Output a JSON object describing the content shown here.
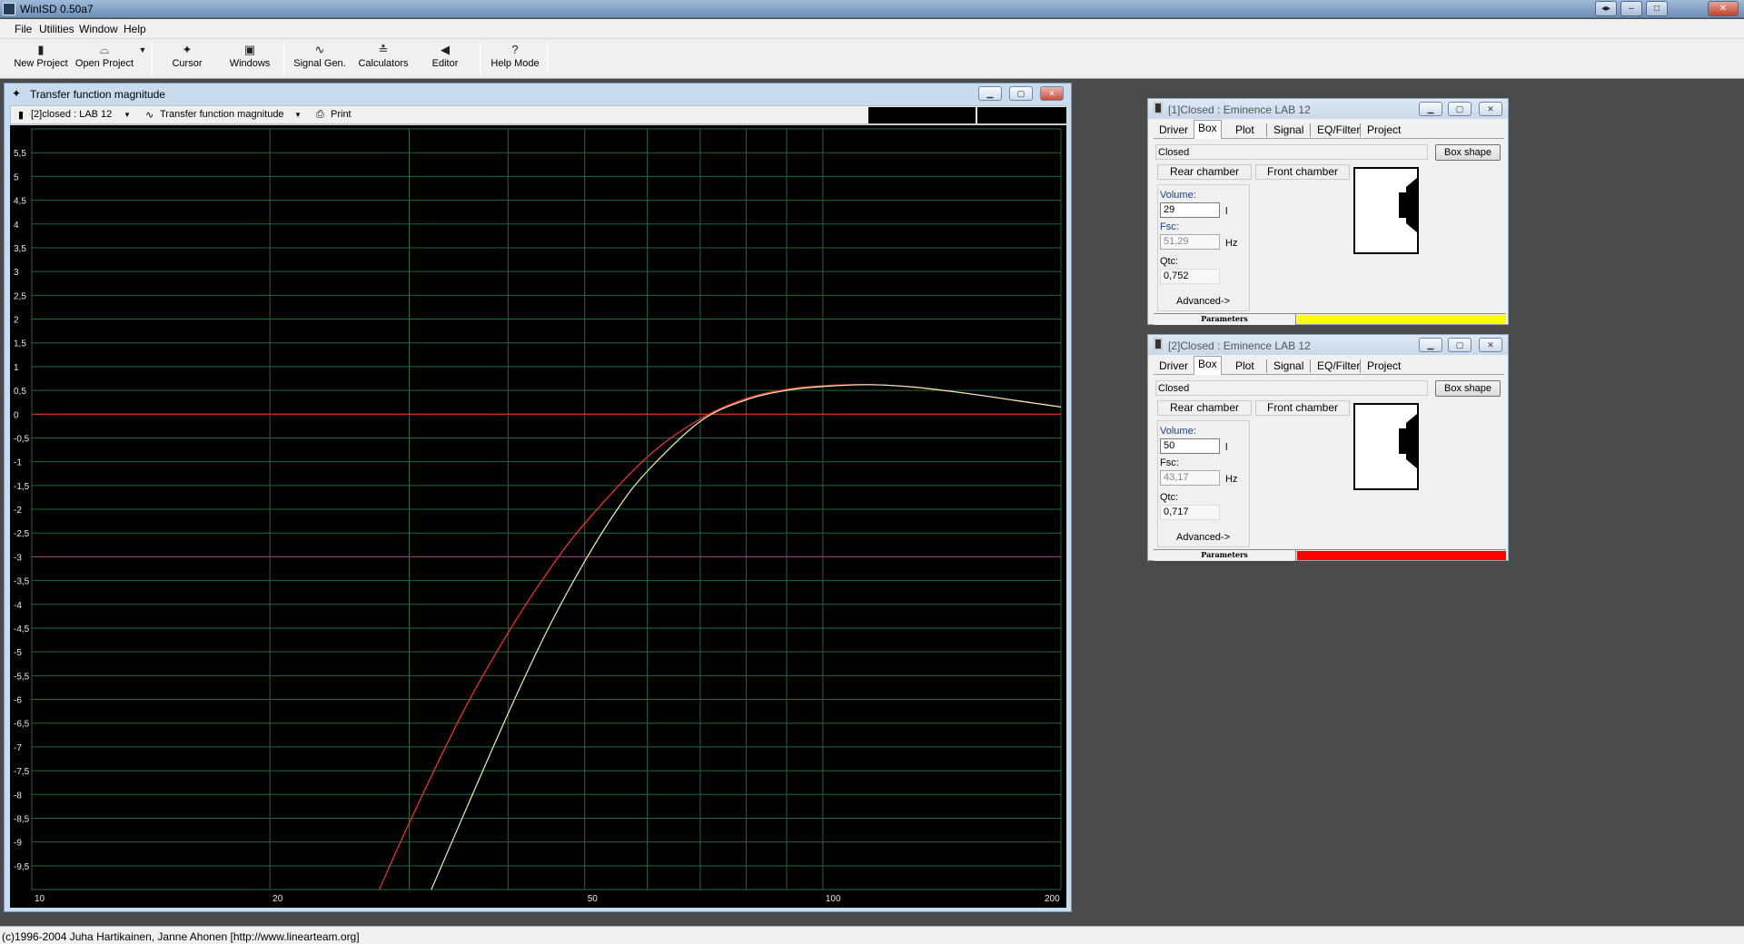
{
  "app": {
    "title": "WinISD 0.50a7"
  },
  "menu": [
    "File",
    "Utilities",
    "Window",
    "Help"
  ],
  "toolbar": [
    {
      "label": "New Project",
      "icon": "new-project-icon"
    },
    {
      "label": "Open Project",
      "icon": "open-project-icon"
    },
    {
      "label": "Cursor",
      "icon": "cursor-icon"
    },
    {
      "label": "Windows",
      "icon": "windows-icon"
    },
    {
      "label": "Signal Gen.",
      "icon": "signal-gen-icon"
    },
    {
      "label": "Calculators",
      "icon": "calculators-icon"
    },
    {
      "label": "Editor",
      "icon": "editor-icon"
    },
    {
      "label": "Help Mode",
      "icon": "help-mode-icon"
    }
  ],
  "graph": {
    "title": "Transfer function magnitude",
    "project_select": "[2]closed : LAB 12",
    "graph_type": "Transfer function magnitude",
    "print_label": "Print"
  },
  "chart_data": {
    "type": "line",
    "x_scale": "log",
    "xlim": [
      10,
      200
    ],
    "ylim": [
      -10,
      6
    ],
    "x_ticks": [
      "10",
      "20",
      "50",
      "100",
      "200"
    ],
    "y_ticks": [
      "5,5",
      "5",
      "4,5",
      "4",
      "3,5",
      "3",
      "2,5",
      "2",
      "1,5",
      "1",
      "0,5",
      "0",
      "-0,5",
      "-1",
      "-1,5",
      "-2",
      "-2,5",
      "-3",
      "-3,5",
      "-4",
      "-4,5",
      "-5",
      "-5,5",
      "-6",
      "-6,5",
      "-7",
      "-7,5",
      "-8",
      "-8,5",
      "-9",
      "-9,5"
    ],
    "reference_lines": [
      {
        "y": 0,
        "color": "#ff2a2a"
      },
      {
        "y": -3,
        "color": "#b03080"
      }
    ],
    "series": [
      {
        "color": "#ff3030",
        "x": [
          27.5,
          30,
          35,
          40,
          45,
          50,
          60,
          70,
          80,
          90,
          100,
          115,
          130,
          150,
          175,
          200
        ],
        "y": [
          -10,
          -8.6,
          -6.3,
          -4.6,
          -3.3,
          -2.3,
          -0.9,
          -0.1,
          0.33,
          0.52,
          0.6,
          0.62,
          0.57,
          0.45,
          0.29,
          0.15
        ]
      },
      {
        "color": "#f0f0b0",
        "x": [
          32,
          35,
          40,
          45,
          50,
          55,
          60,
          70,
          80,
          90,
          100,
          115,
          130,
          150,
          175,
          200
        ],
        "y": [
          -10,
          -8.5,
          -6.3,
          -4.5,
          -3.1,
          -2.0,
          -1.2,
          -0.15,
          0.3,
          0.5,
          0.58,
          0.62,
          0.57,
          0.45,
          0.29,
          0.15
        ]
      }
    ]
  },
  "boxes": [
    {
      "caption": "[1]Closed : Eminence  LAB 12",
      "tabs": [
        "Driver",
        "Box",
        "Plot",
        "Signal",
        "EQ/Filter",
        "Project"
      ],
      "shape": "Closed",
      "box_shape_btn": "Box shape",
      "rear_chamber": "Rear chamber",
      "front_chamber": "Front chamber",
      "volume_label": "Volume:",
      "volume": "29",
      "volume_unit": "l",
      "fsc_label": "Fsc:",
      "fsc": "51,29",
      "fsc_unit": "Hz",
      "qtc_label": "Qtc:",
      "qtc": "0,752",
      "advanced": "Advanced->",
      "params": "Parameters",
      "color": "#ffff00"
    },
    {
      "caption": "[2]Closed : Eminence  LAB 12",
      "tabs": [
        "Driver",
        "Box",
        "Plot",
        "Signal",
        "EQ/Filter",
        "Project"
      ],
      "shape": "Closed",
      "box_shape_btn": "Box shape",
      "rear_chamber": "Rear chamber",
      "front_chamber": "Front chamber",
      "volume_label": "Volume:",
      "volume": "50",
      "volume_unit": "l",
      "fsc_label": "Fsc:",
      "fsc": "43,17",
      "fsc_unit": "Hz",
      "qtc_label": "Qtc:",
      "qtc": "0,717",
      "advanced": "Advanced->",
      "params": "Parameters",
      "color": "#ff0000"
    }
  ],
  "status": "(c)1996-2004 Juha Hartikainen, Janne Ahonen [http://www.linearteam.org]"
}
